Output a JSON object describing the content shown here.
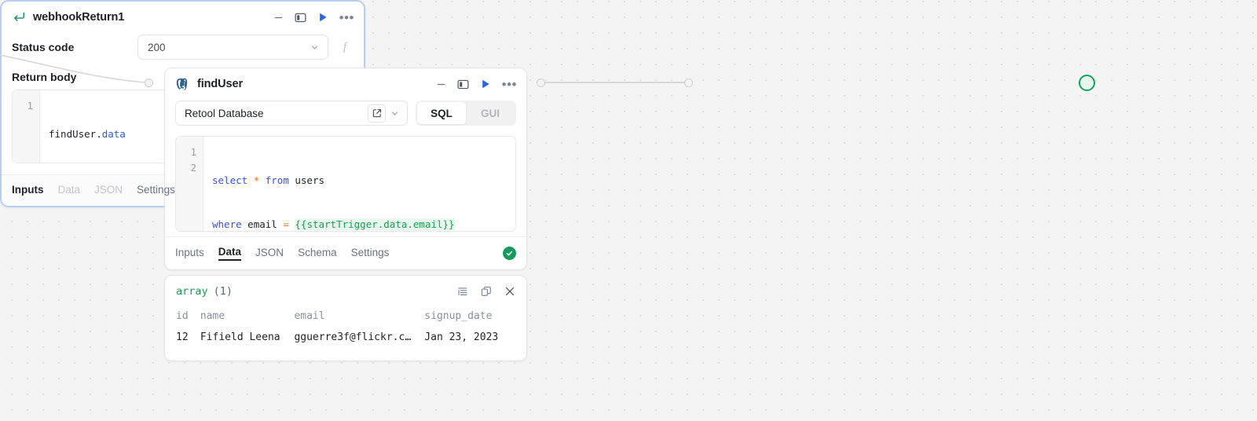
{
  "canvas": {
    "background_color": "#f4f4f4",
    "dot_color": "#e0dedd"
  },
  "find_user_block": {
    "title": "findUser",
    "icon": "postgresql-icon",
    "header_actions": [
      {
        "name": "minimize-button",
        "label": "—"
      },
      {
        "name": "panel-toggle-button",
        "label": ""
      },
      {
        "name": "run-query-button",
        "label": ""
      },
      {
        "name": "more-options-button",
        "label": "•••"
      }
    ],
    "datasource": {
      "name": "Retool Database",
      "open_external_icon": "external-link-icon",
      "dropdown_icon": "chevron-down-icon"
    },
    "mode_toggle": {
      "options": [
        "SQL",
        "GUI"
      ],
      "selected": "SQL"
    },
    "editor": {
      "line_numbers": [
        "1",
        "2"
      ],
      "line1": {
        "kw_select": "select",
        "star": "*",
        "kw_from": "from",
        "table": " users"
      },
      "line2": {
        "kw_where": "where",
        "column": " email ",
        "op": "=",
        "template": "{{startTrigger.data.email}}"
      }
    },
    "tabs": [
      {
        "label": "Inputs",
        "state": "normal"
      },
      {
        "label": "Data",
        "state": "active"
      },
      {
        "label": "JSON",
        "state": "normal"
      },
      {
        "label": "Schema",
        "state": "normal"
      },
      {
        "label": "Settings",
        "state": "normal"
      }
    ],
    "status": {
      "name": "success-check-badge",
      "color": "#139a5b",
      "glyph": "✓"
    }
  },
  "result_panel": {
    "type_label": "array",
    "count_label": "(1)",
    "actions": [
      {
        "name": "expand-list-icon"
      },
      {
        "name": "copy-icon"
      },
      {
        "name": "close-icon"
      }
    ],
    "columns": [
      "id",
      "name",
      "email",
      "signup_date"
    ],
    "rows": [
      {
        "id": "12",
        "name": "Fifield Leena",
        "email": "gguerre3f@flickr.c…",
        "signup_date": "Jan 23, 2023"
      }
    ]
  },
  "webhook_block": {
    "title": "webhookReturn1",
    "icon": "return-arrow-icon",
    "selected_border_color": "#b7cdf5",
    "header_actions": [
      {
        "name": "minimize-button",
        "label": "—"
      },
      {
        "name": "panel-toggle-button",
        "label": ""
      },
      {
        "name": "run-button",
        "label": ""
      },
      {
        "name": "more-options-button",
        "label": "•••"
      }
    ],
    "status_code": {
      "label": "Status code",
      "value": "200",
      "dropdown_icon": "chevron-down-icon",
      "fx_label": "f"
    },
    "return_body": {
      "label": "Return body",
      "line_numbers": [
        "1"
      ],
      "code_prefix": "findUser.",
      "code_prop": "data"
    },
    "tabs": [
      {
        "label": "Inputs",
        "state": "active"
      },
      {
        "label": "Data",
        "state": "disabled"
      },
      {
        "label": "JSON",
        "state": "disabled"
      },
      {
        "label": "Settings",
        "state": "normal"
      }
    ],
    "status": {
      "name": "loading-spinner"
    }
  },
  "connectors": {
    "incoming_edge": {
      "name": "incoming-edge",
      "end_dot": "input-port-findUser"
    },
    "middle_edge": {
      "name": "edge-findUser-to-webhookReturn1",
      "start_dot": "output-port-findUser",
      "end_dot": "input-port-webhookReturn1"
    },
    "end_indicator": {
      "name": "workflow-success-indicator",
      "color": "#16a05c"
    }
  }
}
